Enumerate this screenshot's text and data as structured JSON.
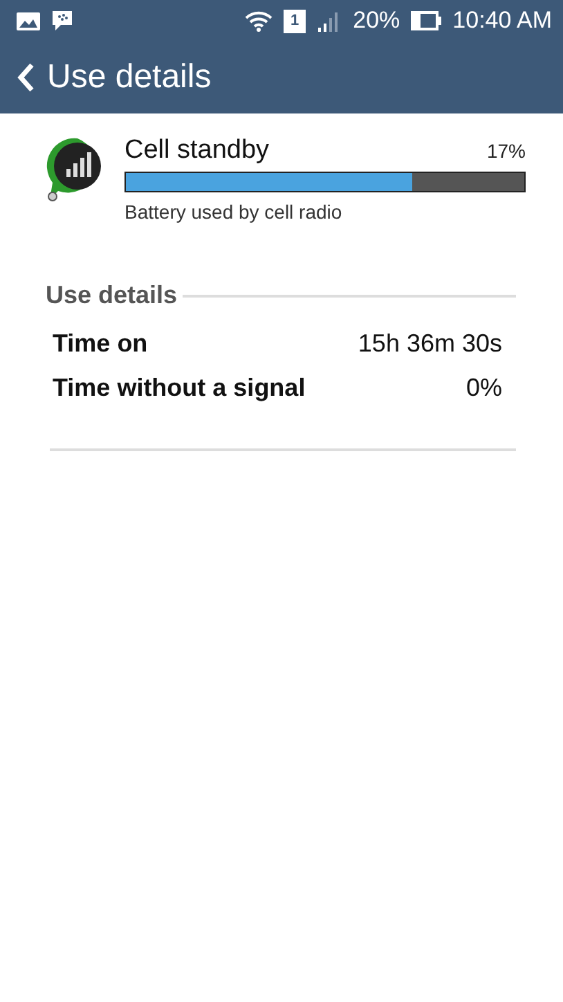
{
  "status_bar": {
    "sim_slot": "1",
    "battery": "20%",
    "time": "10:40 AM"
  },
  "app_bar": {
    "title": "Use details"
  },
  "usage": {
    "name": "Cell standby",
    "percent": "17%",
    "level": 0.72,
    "description": "Battery used by cell radio"
  },
  "section": {
    "title": "Use details"
  },
  "details": [
    {
      "label": "Time on",
      "value": "15h 36m 30s"
    },
    {
      "label": "Time without a signal",
      "value": "0%"
    }
  ]
}
